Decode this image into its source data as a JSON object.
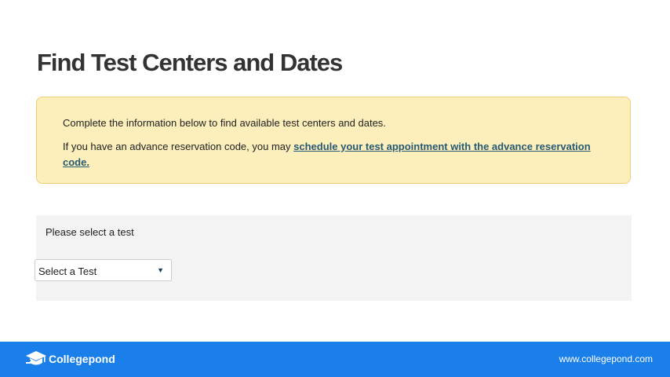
{
  "page": {
    "title": "Find Test Centers and Dates"
  },
  "notice": {
    "line1": "Complete the information below to find available test centers and dates.",
    "line2_prefix": "If you have an advance reservation code, you may ",
    "line2_link": "schedule your test appointment with the advance reservation code."
  },
  "test_selection": {
    "label": "Please select a test",
    "selected_value": "Select a Test",
    "arrow_icon": "triangle-down"
  },
  "footer": {
    "brand_name": "Collegepond",
    "brand_icon": "graduation-cap-logo",
    "url": "www.collegepond.com",
    "background_color": "#1a7fe8"
  },
  "colors": {
    "notice_background": "#fcefbc",
    "notice_border": "#efcf72",
    "link": "#275a72",
    "panel_background": "#f3f3f3"
  }
}
